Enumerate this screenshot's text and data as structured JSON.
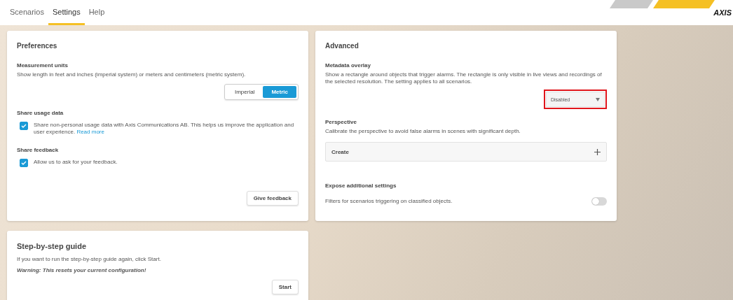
{
  "tabs": [
    {
      "label": "Scenarios",
      "selected": false
    },
    {
      "label": "Settings",
      "selected": true
    },
    {
      "label": "Help",
      "selected": false
    }
  ],
  "logo": "AXIS",
  "preferences": {
    "title": "Preferences",
    "units": {
      "title": "Measurement units",
      "description": "Show length in feet and inches (imperial system) or meters and centimeters (metric system).",
      "options": [
        {
          "label": "Imperial",
          "selected": false
        },
        {
          "label": "Metric",
          "selected": true
        }
      ]
    },
    "usage": {
      "title": "Share usage data",
      "checked": true,
      "text": "Share non-personal usage data with Axis Communications AB. This helps us improve the application and user experience.",
      "link": "Read more"
    },
    "feedback": {
      "title": "Share feedback",
      "checked": true,
      "text": "Allow us to ask for your feedback.",
      "button": "Give feedback"
    }
  },
  "advanced": {
    "title": "Advanced",
    "overlay": {
      "title": "Metadata overlay",
      "description": "Show a rectangle around objects that trigger alarms. The rectangle is only visible in live views and recordings of the selected resolution. The setting applies to all scenarios.",
      "value": "Disabled",
      "highlighted": true
    },
    "perspective": {
      "title": "Perspective",
      "description": "Calibrate the perspective to avoid false alarms in scenes with significant depth.",
      "button": "Create"
    },
    "expose": {
      "title": "Expose additional settings",
      "description": "Filters for scenarios triggering on classified objects.",
      "on": false
    }
  },
  "guide": {
    "title": "Step-by-step guide",
    "text": "If you want to run the step-by-step guide again, click Start.",
    "warning": "Warning: This resets your current configuration!",
    "button": "Start"
  }
}
